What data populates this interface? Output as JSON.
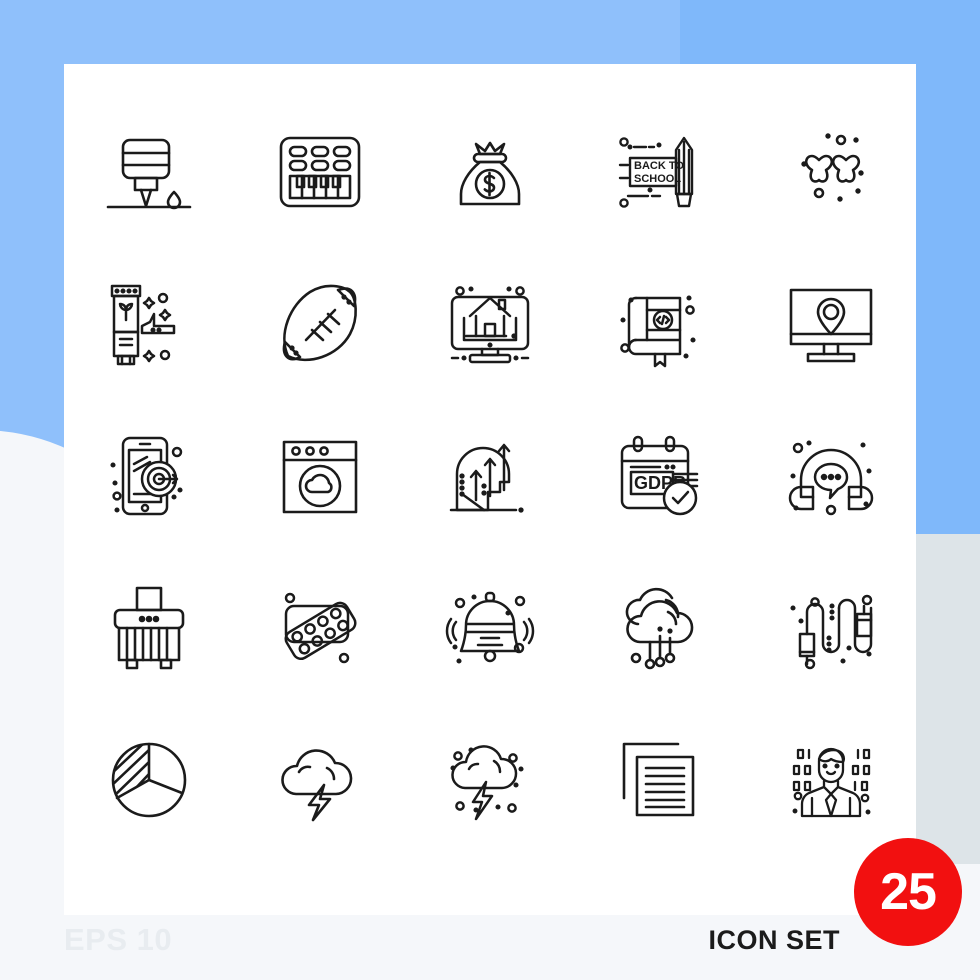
{
  "footer": {
    "eps_label": "EPS 10",
    "set_label": "ICON SET",
    "badge_count": "25"
  },
  "colors": {
    "background": "#f5f7fa",
    "blob_blue": "#8fc0fb",
    "blob_blue_dark": "#7fb8fa",
    "blob_gray": "#dde4e8",
    "card": "#ffffff",
    "stroke": "#1b1b1b",
    "badge_red": "#f21010",
    "eps_text": "#e8ecf0",
    "set_text": "#1b1b1b"
  },
  "grid": {
    "columns": 5,
    "rows": 5,
    "total": 25
  },
  "icons": [
    {
      "id": 1,
      "name": "laser-engraving-machine-icon",
      "label": "Laser Engraving Machine",
      "row": 1,
      "col": 1
    },
    {
      "id": 2,
      "name": "midi-keyboard-icon",
      "label": "Midi Keyboard",
      "row": 1,
      "col": 2
    },
    {
      "id": 3,
      "name": "money-bag-icon",
      "label": "Money Bag",
      "row": 1,
      "col": 3,
      "text": "$"
    },
    {
      "id": 4,
      "name": "back-to-school-icon",
      "label": "Back To School",
      "row": 1,
      "col": 4,
      "text": "BACK TO SCHOOL"
    },
    {
      "id": 5,
      "name": "stars-rating-icon",
      "label": "Stars",
      "row": 1,
      "col": 5
    },
    {
      "id": 6,
      "name": "cosmetic-cream-tube-icon",
      "label": "Cosmetic Cream Tube",
      "row": 2,
      "col": 1
    },
    {
      "id": 7,
      "name": "rugby-ball-icon",
      "label": "Rugby Ball",
      "row": 2,
      "col": 2
    },
    {
      "id": 8,
      "name": "online-real-estate-icon",
      "label": "Online Real Estate",
      "row": 2,
      "col": 3
    },
    {
      "id": 9,
      "name": "coding-book-icon",
      "label": "Coding Book",
      "row": 2,
      "col": 4
    },
    {
      "id": 10,
      "name": "online-location-monitor-icon",
      "label": "Online Location",
      "row": 2,
      "col": 5
    },
    {
      "id": 11,
      "name": "mobile-targeting-icon",
      "label": "Mobile Targeting",
      "row": 3,
      "col": 1
    },
    {
      "id": 12,
      "name": "browser-cloud-icon",
      "label": "Browser Cloud",
      "row": 3,
      "col": 2
    },
    {
      "id": 13,
      "name": "mind-growth-icon",
      "label": "Mind Growth",
      "row": 3,
      "col": 3
    },
    {
      "id": 14,
      "name": "gdpr-compliance-icon",
      "label": "GDPR Compliance",
      "row": 3,
      "col": 4,
      "text": "GDPR"
    },
    {
      "id": 15,
      "name": "support-headphones-icon",
      "label": "Support Headphones",
      "row": 3,
      "col": 5
    },
    {
      "id": 16,
      "name": "paper-shredder-icon",
      "label": "Paper Shredder",
      "row": 4,
      "col": 1
    },
    {
      "id": 17,
      "name": "pill-blister-pack-icon",
      "label": "Pills Blister Pack",
      "row": 4,
      "col": 2
    },
    {
      "id": 18,
      "name": "ringing-bell-icon",
      "label": "Ringing Bell",
      "row": 4,
      "col": 3
    },
    {
      "id": 19,
      "name": "cloud-computing-icon",
      "label": "Cloud Computing",
      "row": 4,
      "col": 4
    },
    {
      "id": 20,
      "name": "cable-connectors-icon",
      "label": "Cable Connectors",
      "row": 4,
      "col": 5
    },
    {
      "id": 21,
      "name": "pie-chart-icon",
      "label": "Pie Chart",
      "row": 5,
      "col": 1
    },
    {
      "id": 22,
      "name": "cloud-lightning-icon",
      "label": "Cloud Lightning",
      "row": 5,
      "col": 2
    },
    {
      "id": 23,
      "name": "thunderstorm-icon",
      "label": "Thunderstorm",
      "row": 5,
      "col": 3
    },
    {
      "id": 24,
      "name": "copy-documents-icon",
      "label": "Copy Documents",
      "row": 5,
      "col": 4
    },
    {
      "id": 25,
      "name": "data-scientist-icon",
      "label": "Data Scientist",
      "row": 5,
      "col": 5
    }
  ]
}
